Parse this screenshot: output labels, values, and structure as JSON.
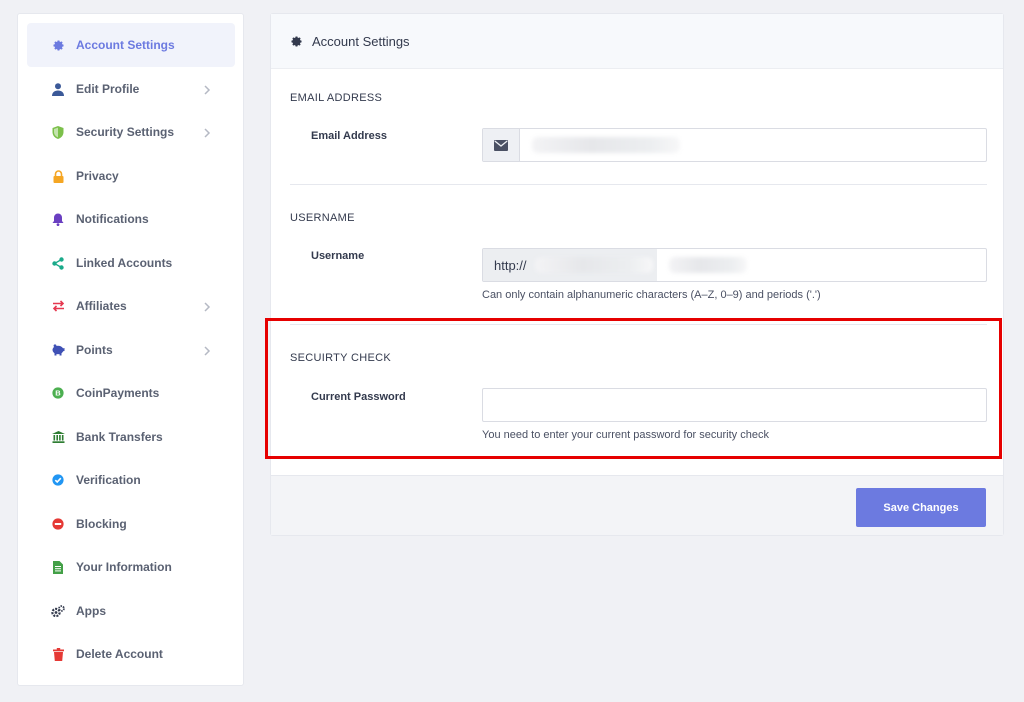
{
  "sidebar": {
    "items": [
      {
        "label": "Account Settings",
        "icon": "gear-icon",
        "color": "#6c7ae0",
        "active": true,
        "chevron": false
      },
      {
        "label": "Edit Profile",
        "icon": "user-icon",
        "color": "#3b5998",
        "chevron": true
      },
      {
        "label": "Security Settings",
        "icon": "shield-icon",
        "color": "#7cc04b",
        "chevron": true
      },
      {
        "label": "Privacy",
        "icon": "lock-icon",
        "color": "#f5a623",
        "chevron": false
      },
      {
        "label": "Notifications",
        "icon": "bell-icon",
        "color": "#6a3fc1",
        "chevron": false
      },
      {
        "label": "Linked Accounts",
        "icon": "share-icon",
        "color": "#1aaa8a",
        "chevron": false
      },
      {
        "label": "Affiliates",
        "icon": "exchange-icon",
        "color": "#e53950",
        "chevron": true
      },
      {
        "label": "Points",
        "icon": "piggy-bank-icon",
        "color": "#3f51b5",
        "chevron": true
      },
      {
        "label": "CoinPayments",
        "icon": "coin-icon",
        "color": "#4caf50",
        "chevron": false
      },
      {
        "label": "Bank Transfers",
        "icon": "bank-icon",
        "color": "#2e7d32",
        "chevron": false
      },
      {
        "label": "Verification",
        "icon": "check-badge-icon",
        "color": "#2196f3",
        "chevron": false
      },
      {
        "label": "Blocking",
        "icon": "block-icon",
        "color": "#e53935",
        "chevron": false
      },
      {
        "label": "Your Information",
        "icon": "document-icon",
        "color": "#43a047",
        "chevron": false
      },
      {
        "label": "Apps",
        "icon": "gears-icon",
        "color": "#333a4d",
        "chevron": false
      },
      {
        "label": "Delete Account",
        "icon": "trash-icon",
        "color": "#e53935",
        "chevron": false
      }
    ]
  },
  "panel": {
    "title": "Account Settings",
    "email_section": "EMAIL ADDRESS",
    "email_label": "Email Address",
    "username_section": "USERNAME",
    "username_label": "Username",
    "username_prefix": "http://",
    "username_help": "Can only contain alphanumeric characters (A–Z, 0–9) and periods ('.')",
    "security_section": "SECUIRTY CHECK",
    "password_label": "Current Password",
    "password_help": "You need to enter your current password for security check",
    "save_label": "Save Changes"
  },
  "colors": {
    "accent": "#6c7ae0",
    "highlight": "#e60000"
  }
}
